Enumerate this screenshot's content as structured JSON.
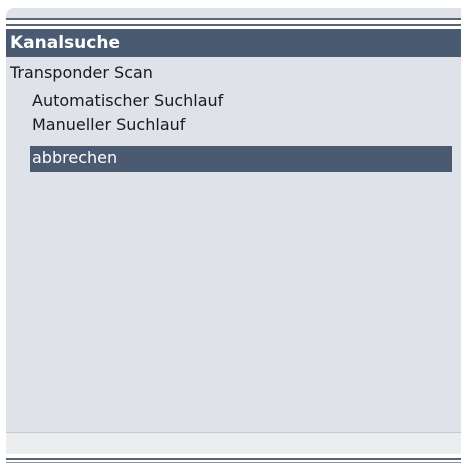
{
  "window": {
    "title": "Kanalsuche"
  },
  "section": {
    "label": "Transponder Scan"
  },
  "menu": {
    "items": [
      {
        "label": "Automatischer Suchlauf"
      },
      {
        "label": "Manueller Suchlauf"
      },
      {
        "label": "abbrechen"
      }
    ],
    "selected": "abbrechen"
  },
  "colors": {
    "accent": "#4a5a70",
    "panel_background": "#dfe2e8",
    "selected_text": "#ffffff"
  }
}
